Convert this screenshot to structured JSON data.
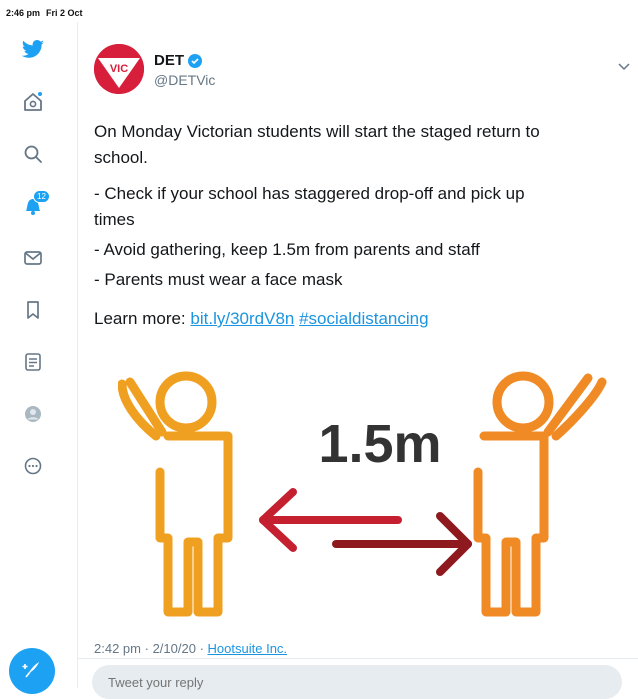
{
  "status_bar": {
    "time": "2:46 pm",
    "date": "Fri 2 Oct"
  },
  "sidebar": {
    "items": [
      {
        "icon": "twitter-bird-icon"
      },
      {
        "icon": "home-icon"
      },
      {
        "icon": "search-icon"
      },
      {
        "icon": "notifications-icon",
        "badge": "12"
      },
      {
        "icon": "messages-icon"
      },
      {
        "icon": "bookmarks-icon"
      },
      {
        "icon": "lists-icon"
      },
      {
        "icon": "profile-icon"
      },
      {
        "icon": "more-icon"
      }
    ],
    "compose_icon": "compose-tweet-icon"
  },
  "tweet": {
    "author_name": "DET",
    "author_handle": "@DETVic",
    "avatar_text": "VIC",
    "text_line1": "On Monday Victorian students will start the staged return to",
    "text_line2": "school.",
    "bullet1_line1": "- Check if your school has staggered drop-off and pick up",
    "bullet1_line2": "times",
    "bullet2": "- Avoid gathering, keep 1.5m from parents and staff",
    "bullet3": "- Parents must wear a face mask",
    "learn_more": "Learn more:",
    "link": "bit.ly/30rdV8n",
    "hashtag": "#socialdistancing",
    "graphic_label": "1.5m",
    "time": "2:42 pm",
    "date": "2/10/20",
    "separator": "·",
    "source": "Hootsuite Inc."
  },
  "reply": {
    "placeholder": "Tweet your reply"
  },
  "colors": {
    "twitter_blue": "#1da1f2",
    "figure_left": "#f0a020",
    "figure_right": "#f08a24",
    "arrow_left": "#c42030",
    "arrow_right": "#8e1a20",
    "avatar_red": "#d71e3a"
  }
}
